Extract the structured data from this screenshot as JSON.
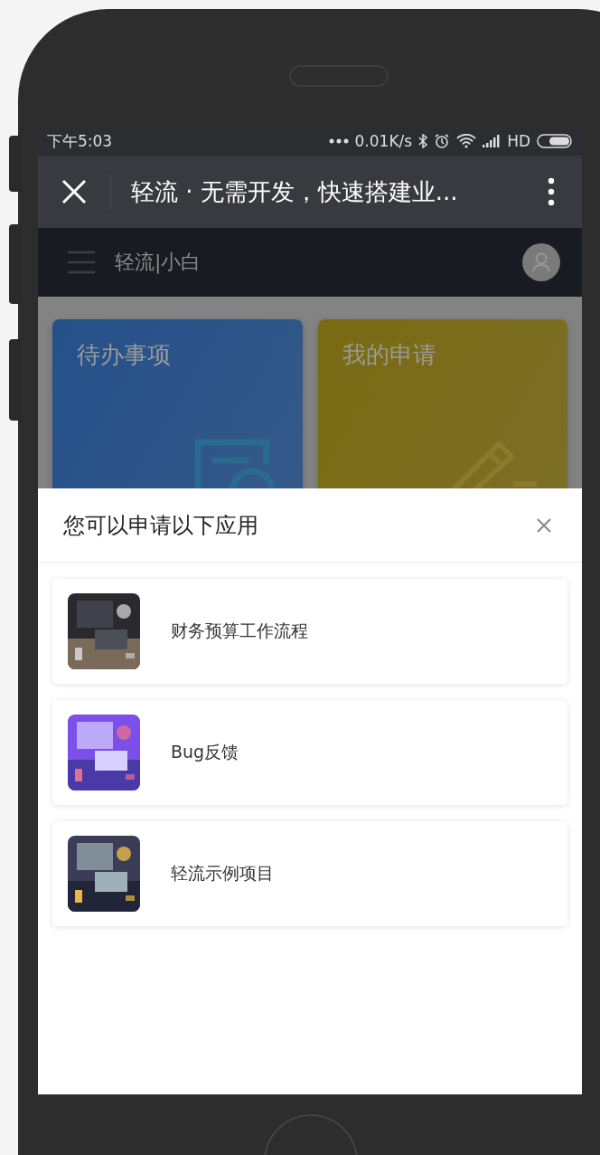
{
  "status_bar": {
    "time": "下午5:03",
    "network_speed": "0.01K/s",
    "network_type": "HD"
  },
  "nav_bar": {
    "title": "轻流 · 无需开发，快速搭建业..."
  },
  "app_header": {
    "brand": "轻流|小白"
  },
  "tiles": [
    {
      "title": "待办事项",
      "kind": "document",
      "color": "#24508a"
    },
    {
      "title": "我的申请",
      "kind": "pencil",
      "color": "#7a6a12"
    }
  ],
  "sheet": {
    "title": "您可以申请以下应用",
    "items": [
      {
        "name": "财务预算工作流程",
        "kind": "picture"
      },
      {
        "name": "Bug反馈",
        "kind": "picture"
      },
      {
        "name": "轻流示例项目",
        "kind": "picture"
      }
    ]
  }
}
